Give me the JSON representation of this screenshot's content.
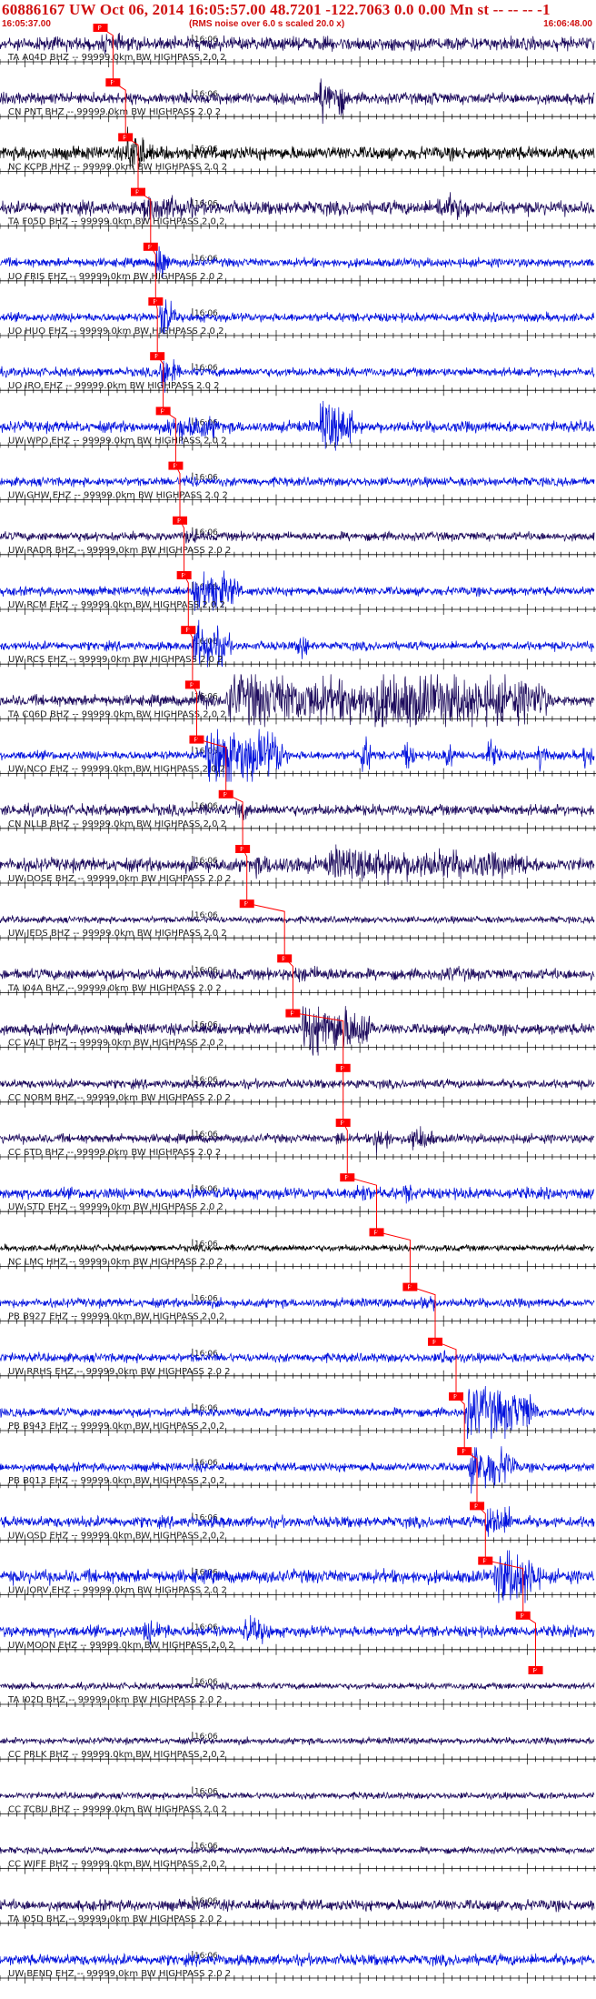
{
  "header": {
    "title": "60886167 UW Oct 06, 2014 16:05:57.00   48.7201 -122.7063  0.0 0.00 Mn st -- -- -- -1",
    "start_time": "16:05:37.00",
    "rms_note": "(RMS noise over 6.0 s scaled 20.0 x)",
    "end_time": "16:06:48.00"
  },
  "chart_data": {
    "type": "seismogram",
    "time_axis": {
      "start": "16:05:37.00",
      "end": "16:06:48.00",
      "minute_mark": "16:06",
      "minute_mark_seconds": 23
    },
    "pick_label": "P",
    "colors": {
      "dark_trace": "#1c0a5c",
      "blue_trace": "#0010dd",
      "black_trace": "#000000",
      "pick": "#ff0000",
      "axis": "#000000"
    },
    "traces": [
      {
        "label": "TA A04D BHZ -- 99999.0km BW  HIGHPASS  2.0  2",
        "color": "dark",
        "p_time": 12.0,
        "amp": 6,
        "events": [
          [
            12,
            3,
            10
          ]
        ]
      },
      {
        "label": "CN PNT BHZ -- 99999.0km BW  HIGHPASS  2.0  2",
        "color": "dark",
        "p_time": 13.5,
        "amp": 5,
        "events": [
          [
            14,
            2,
            6
          ],
          [
            38,
            3,
            22
          ],
          [
            51,
            2,
            8
          ]
        ]
      },
      {
        "label": "NC KCPB HHZ -- 99999.0km BW  HIGHPASS  2.0  2",
        "color": "black",
        "p_time": 15.0,
        "amp": 6,
        "events": [
          [
            15,
            2,
            28
          ],
          [
            17,
            5,
            8
          ]
        ]
      },
      {
        "label": "TA F05D BHZ -- 99999.0km BW  HIGHPASS  2.0  2",
        "color": "dark",
        "p_time": 16.5,
        "amp": 6,
        "events": [
          [
            17,
            6,
            14
          ],
          [
            35,
            15,
            7
          ],
          [
            52,
            4,
            14
          ]
        ]
      },
      {
        "label": "UO FRIS EHZ -- 99999.0km BW  HIGHPASS  2.0  2",
        "color": "blue",
        "p_time": 18.0,
        "amp": 4,
        "events": [
          [
            18.5,
            1,
            26
          ]
        ]
      },
      {
        "label": "UO HUO EHZ -- 99999.0km BW  HIGHPASS  2.0  2",
        "color": "blue",
        "p_time": 18.6,
        "amp": 4,
        "events": [
          [
            19,
            1.2,
            26
          ]
        ]
      },
      {
        "label": "UO IRO EHZ -- 99999.0km BW  HIGHPASS  2.0  2",
        "color": "blue",
        "p_time": 18.8,
        "amp": 4,
        "events": [
          [
            19,
            1.5,
            26
          ]
        ]
      },
      {
        "label": "UW WPO EHZ -- 99999.0km BW  HIGHPASS  2.0  2",
        "color": "blue",
        "p_time": 19.5,
        "amp": 5,
        "events": [
          [
            20,
            6,
            14
          ],
          [
            38,
            4,
            26
          ]
        ]
      },
      {
        "label": "UW GHW EHZ -- 99999.0km BW  HIGHPASS  2.0  2",
        "color": "blue",
        "p_time": 21.0,
        "amp": 4,
        "events": [
          [
            21.5,
            2,
            8
          ]
        ]
      },
      {
        "label": "UW RADR BHZ -- 99999.0km BW  HIGHPASS  2.0  2",
        "color": "dark",
        "p_time": 21.5,
        "amp": 4,
        "events": [
          [
            22,
            2,
            8
          ]
        ]
      },
      {
        "label": "UW RCM EHZ -- 99999.0km BW  HIGHPASS  2.0  2",
        "color": "blue",
        "p_time": 22.0,
        "amp": 4,
        "events": [
          [
            23,
            5,
            22
          ]
        ]
      },
      {
        "label": "UW RCS EHZ -- 99999.0km BW  HIGHPASS  2.0  2",
        "color": "blue",
        "p_time": 22.5,
        "amp": 4,
        "events": [
          [
            23,
            4,
            24
          ],
          [
            35.5,
            0.8,
            20
          ]
        ]
      },
      {
        "label": "TA C06D BHZ -- 99999.0km BW  HIGHPASS  2.0  2",
        "color": "dark",
        "p_time": 23.0,
        "amp": 5,
        "events": [
          [
            23.5,
            2,
            10
          ],
          [
            27,
            20,
            26
          ],
          [
            44,
            21,
            28
          ]
        ]
      },
      {
        "label": "UW NCO EHZ -- 99999.0km BW  HIGHPASS  2.0  2",
        "color": "blue",
        "p_time": 23.5,
        "amp": 4,
        "events": [
          [
            24.5,
            9,
            30
          ],
          [
            43,
            1,
            22
          ],
          [
            48,
            1,
            18
          ],
          [
            53,
            1,
            16
          ],
          [
            58,
            1,
            20
          ],
          [
            64,
            1,
            18
          ],
          [
            69.5,
            1,
            16
          ]
        ]
      },
      {
        "label": "CN NLLB BHZ -- 99999.0km BW  HIGHPASS  2.0  2",
        "color": "dark",
        "p_time": 27.0,
        "amp": 5,
        "events": [
          [
            28,
            1.5,
            12
          ]
        ]
      },
      {
        "label": "UW DOSE BHZ -- 99999.0km BW  HIGHPASS  2.0  2",
        "color": "dark",
        "p_time": 29.0,
        "amp": 6,
        "events": [
          [
            30,
            9,
            10
          ],
          [
            39,
            24,
            16
          ]
        ]
      },
      {
        "label": "UW JEDS BHZ -- 99999.0km BW  HIGHPASS  2.0  2",
        "color": "dark",
        "p_time": 29.5,
        "amp": 3,
        "events": []
      },
      {
        "label": "TA I04A BHZ -- 99999.0km BW  HIGHPASS  2.0  2",
        "color": "dark",
        "p_time": 34.0,
        "amp": 5,
        "events": [
          [
            35,
            7,
            8
          ],
          [
            53,
            4,
            8
          ]
        ]
      },
      {
        "label": "CC VALT BHZ -- 99999.0km BW  HIGHPASS  2.0  2",
        "color": "dark",
        "p_time": 35.0,
        "amp": 5,
        "events": [
          [
            36,
            8,
            26
          ]
        ]
      },
      {
        "label": "CC NORM BHZ -- 99999.0km BW  HIGHPASS  2.0  2",
        "color": "dark",
        "p_time": 41.0,
        "amp": 4,
        "events": [
          [
            42,
            1,
            8
          ]
        ]
      },
      {
        "label": "CC STD BHZ -- 99999.0km BW  HIGHPASS  2.0  2",
        "color": "dark",
        "p_time": 41.0,
        "amp": 4,
        "events": [
          [
            40,
            1,
            10
          ],
          [
            44.5,
            2,
            14
          ],
          [
            49,
            2.5,
            14
          ]
        ]
      },
      {
        "label": "UW STD EHZ -- 99999.0km BW  HIGHPASS  2.0  2",
        "color": "blue",
        "p_time": 41.5,
        "amp": 5,
        "events": [
          [
            42,
            2,
            12
          ],
          [
            48,
            2,
            10
          ]
        ]
      },
      {
        "label": "NC LMC HHZ -- 99999.0km BW  HIGHPASS  2.0  2",
        "color": "black",
        "p_time": 45.0,
        "amp": 3,
        "events": []
      },
      {
        "label": "PB B927 EHZ -- 99999.0km BW  HIGHPASS  2.0  2",
        "color": "blue",
        "p_time": 49.0,
        "amp": 4,
        "events": [
          [
            50,
            2,
            10
          ]
        ]
      },
      {
        "label": "UW RRHS EHZ -- 99999.0km BW  HIGHPASS  2.0  2",
        "color": "blue",
        "p_time": 52.0,
        "amp": 4,
        "events": [
          [
            52.5,
            1.5,
            10
          ]
        ]
      },
      {
        "label": "PB B943 EHZ -- 99999.0km BW  HIGHPASS  2.0  2",
        "color": "blue",
        "p_time": 54.5,
        "amp": 4,
        "events": [
          [
            55.5,
            8,
            26
          ]
        ]
      },
      {
        "label": "PB B013 EHZ -- 99999.0km BW  HIGHPASS  2.0  2",
        "color": "blue",
        "p_time": 55.5,
        "amp": 4,
        "events": [
          [
            56,
            5,
            24
          ]
        ]
      },
      {
        "label": "UW OSD EHZ -- 99999.0km BW  HIGHPASS  2.0  2",
        "color": "blue",
        "p_time": 57.0,
        "amp": 5,
        "events": [
          [
            58,
            3,
            18
          ]
        ]
      },
      {
        "label": "UW JORV EHZ -- 99999.0km BW  HIGHPASS  2.0  2",
        "color": "blue",
        "p_time": 58.0,
        "amp": 6,
        "events": [
          [
            59,
            5,
            30
          ]
        ]
      },
      {
        "label": "UW MOON EHZ -- 99999.0km BW  HIGHPASS  2.0  2",
        "color": "blue",
        "p_time": 62.5,
        "amp": 5,
        "events": [
          [
            17,
            3,
            12
          ],
          [
            29,
            3,
            14
          ]
        ]
      },
      {
        "label": "TA I02D BHZ -- 99999.0km BW  HIGHPASS  2.0  2",
        "color": "dark",
        "p_time": 64.0,
        "amp": 3,
        "events": []
      },
      {
        "label": "CC PRLK BHZ -- 99999.0km BW  HIGHPASS  2.0  2",
        "color": "dark",
        "p_time": null,
        "amp": 3,
        "events": []
      },
      {
        "label": "CC TCBU BHZ -- 99999.0km BW  HIGHPASS  2.0  2",
        "color": "dark",
        "p_time": null,
        "amp": 3,
        "events": []
      },
      {
        "label": "CC WIFE BHZ -- 99999.0km BW  HIGHPASS  2.0  2",
        "color": "dark",
        "p_time": null,
        "amp": 3,
        "events": []
      },
      {
        "label": "TA I05D BHZ -- 99999.0km BW  HIGHPASS  2.0  2",
        "color": "dark",
        "p_time": null,
        "amp": 5,
        "events": []
      },
      {
        "label": "UW BEND EHZ -- 99999.0km BW  HIGHPASS  2.0  2",
        "color": "blue",
        "p_time": null,
        "amp": 5,
        "events": []
      }
    ]
  }
}
